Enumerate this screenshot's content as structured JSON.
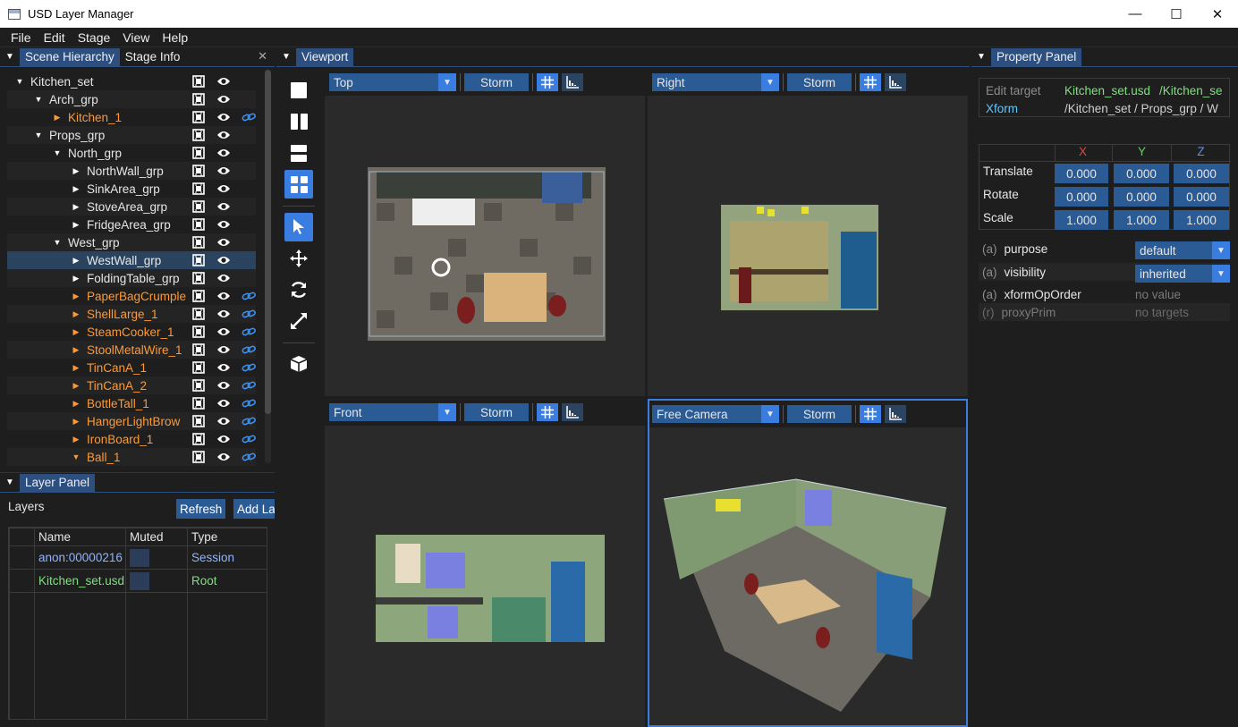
{
  "window": {
    "title": "USD Layer Manager",
    "minimize": "—",
    "maximize": "☐",
    "close": "✕"
  },
  "menu": [
    "File",
    "Edit",
    "Stage",
    "View",
    "Help"
  ],
  "left_top": {
    "tabs": [
      "Scene Hierarchy",
      "Stage Info"
    ],
    "close": "✕",
    "rows": [
      {
        "name": "Kitchen_set",
        "indent": 0,
        "tri": "▼",
        "orange": false,
        "link": false,
        "alt": false,
        "sel": false
      },
      {
        "name": "Arch_grp",
        "indent": 1,
        "tri": "▼",
        "orange": false,
        "link": false,
        "alt": true,
        "sel": false
      },
      {
        "name": "Kitchen_1",
        "indent": 2,
        "tri": "▶",
        "orange": true,
        "link": true,
        "alt": false,
        "sel": false
      },
      {
        "name": "Props_grp",
        "indent": 1,
        "tri": "▼",
        "orange": false,
        "link": false,
        "alt": true,
        "sel": false
      },
      {
        "name": "North_grp",
        "indent": 2,
        "tri": "▼",
        "orange": false,
        "link": false,
        "alt": false,
        "sel": false
      },
      {
        "name": "NorthWall_grp",
        "indent": 3,
        "tri": "▶",
        "orange": false,
        "link": false,
        "alt": true,
        "sel": false
      },
      {
        "name": "SinkArea_grp",
        "indent": 3,
        "tri": "▶",
        "orange": false,
        "link": false,
        "alt": false,
        "sel": false
      },
      {
        "name": "StoveArea_grp",
        "indent": 3,
        "tri": "▶",
        "orange": false,
        "link": false,
        "alt": true,
        "sel": false
      },
      {
        "name": "FridgeArea_grp",
        "indent": 3,
        "tri": "▶",
        "orange": false,
        "link": false,
        "alt": false,
        "sel": false
      },
      {
        "name": "West_grp",
        "indent": 2,
        "tri": "▼",
        "orange": false,
        "link": false,
        "alt": true,
        "sel": false
      },
      {
        "name": "WestWall_grp",
        "indent": 3,
        "tri": "▶",
        "orange": false,
        "link": false,
        "alt": false,
        "sel": true
      },
      {
        "name": "FoldingTable_grp",
        "indent": 3,
        "tri": "▶",
        "orange": false,
        "link": false,
        "alt": true,
        "sel": false
      },
      {
        "name": "PaperBagCrumple",
        "indent": 3,
        "tri": "▶",
        "orange": true,
        "link": true,
        "alt": false,
        "sel": false
      },
      {
        "name": "ShellLarge_1",
        "indent": 3,
        "tri": "▶",
        "orange": true,
        "link": true,
        "alt": true,
        "sel": false
      },
      {
        "name": "SteamCooker_1",
        "indent": 3,
        "tri": "▶",
        "orange": true,
        "link": true,
        "alt": false,
        "sel": false
      },
      {
        "name": "StoolMetalWire_1",
        "indent": 3,
        "tri": "▶",
        "orange": true,
        "link": true,
        "alt": true,
        "sel": false
      },
      {
        "name": "TinCanA_1",
        "indent": 3,
        "tri": "▶",
        "orange": true,
        "link": true,
        "alt": false,
        "sel": false
      },
      {
        "name": "TinCanA_2",
        "indent": 3,
        "tri": "▶",
        "orange": true,
        "link": true,
        "alt": true,
        "sel": false
      },
      {
        "name": "BottleTall_1",
        "indent": 3,
        "tri": "▶",
        "orange": true,
        "link": true,
        "alt": false,
        "sel": false
      },
      {
        "name": "HangerLightBrow",
        "indent": 3,
        "tri": "▶",
        "orange": true,
        "link": true,
        "alt": true,
        "sel": false
      },
      {
        "name": "IronBoard_1",
        "indent": 3,
        "tri": "▶",
        "orange": true,
        "link": true,
        "alt": false,
        "sel": false
      },
      {
        "name": "Ball_1",
        "indent": 3,
        "tri": "▼",
        "orange": true,
        "link": true,
        "alt": true,
        "sel": false
      }
    ]
  },
  "layer_panel": {
    "tab": "Layer Panel",
    "label": "Layers",
    "refresh": "Refresh",
    "add": "Add La",
    "columns": [
      "Name",
      "Muted",
      "Type"
    ],
    "rows": [
      {
        "name": "anon:00000216",
        "type": "Session",
        "name_color": "#8fb4ff",
        "type_color": "#8fb4ff"
      },
      {
        "name": "Kitchen_set.usd",
        "type": "Root",
        "name_color": "#7ee07e",
        "type_color": "#7ee07e"
      }
    ]
  },
  "viewport": {
    "tab": "Viewport",
    "renderer": "Storm",
    "views": [
      "Top",
      "Right",
      "Front",
      "Free Camera"
    ]
  },
  "properties": {
    "tab": "Property Panel",
    "edit_target_label": "Edit target",
    "edit_target_file": "Kitchen_set.usd",
    "edit_target_path": "/Kitchen_se",
    "type": "Xform",
    "prim_path": "/Kitchen_set / Props_grp / W",
    "axes": [
      "X",
      "Y",
      "Z"
    ],
    "transform_rows": [
      {
        "label": "Translate",
        "values": [
          "0.000",
          "0.000",
          "0.000"
        ]
      },
      {
        "label": "Rotate",
        "values": [
          "0.000",
          "0.000",
          "0.000"
        ]
      },
      {
        "label": "Scale",
        "values": [
          "1.000",
          "1.000",
          "1.000"
        ]
      }
    ],
    "attrs": [
      {
        "tag": "(a)",
        "name": "purpose",
        "value": "default",
        "kind": "dropdown"
      },
      {
        "tag": "(a)",
        "name": "visibility",
        "value": "inherited",
        "kind": "dropdown"
      },
      {
        "tag": "(a)",
        "name": "xformOpOrder",
        "value": "no value",
        "kind": "text"
      },
      {
        "tag": "(r)",
        "name": "proxyPrim",
        "value": "no targets",
        "kind": "text"
      }
    ]
  },
  "colors": {
    "accent": "#3a7de0",
    "button": "#2b5b95",
    "orange": "#ff9933",
    "green": "#7ee07e",
    "cyan": "#5fc8ff"
  }
}
